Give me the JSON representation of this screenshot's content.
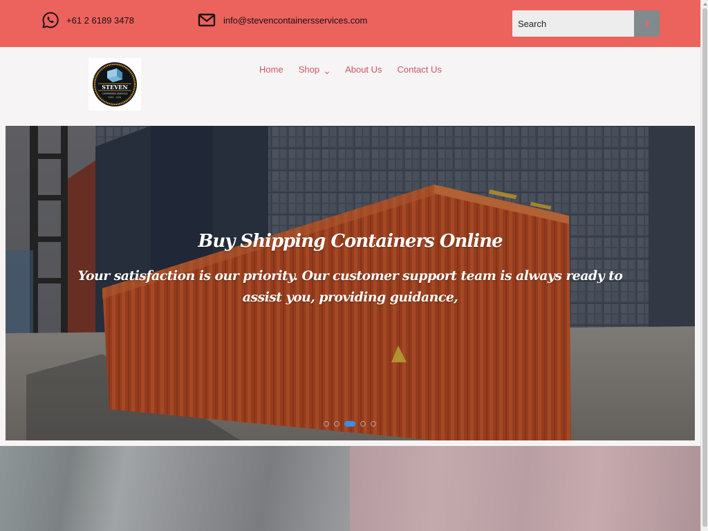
{
  "topbar": {
    "phone": "+61 2 6189 3478",
    "email": "info@stevencontainersservices.com",
    "phone_icon": "whatsapp-icon",
    "email_icon": "envelope-icon",
    "search": {
      "placeholder": "Search",
      "button_icon": "search-icon"
    }
  },
  "colors": {
    "topbar_bg": "#ec635e",
    "nav_link": "#c85768",
    "active_dot": "#3a8ee6",
    "search_button": "#818b8d"
  },
  "logo": {
    "name": "STEVEN",
    "tagline": "CONTAINERS SERVICES",
    "years": "2002 - 2021"
  },
  "nav": {
    "items": [
      {
        "label": "Home"
      },
      {
        "label": "Shop",
        "has_dropdown": true
      },
      {
        "label": "About Us"
      },
      {
        "label": "Contact Us"
      }
    ]
  },
  "hero": {
    "title": "Buy Shipping Containers Online",
    "subtitle": "Your satisfaction is our priority. Our customer support team is always ready to assist you, providing guidance,",
    "slides_total": 5,
    "active_slide": 3
  }
}
